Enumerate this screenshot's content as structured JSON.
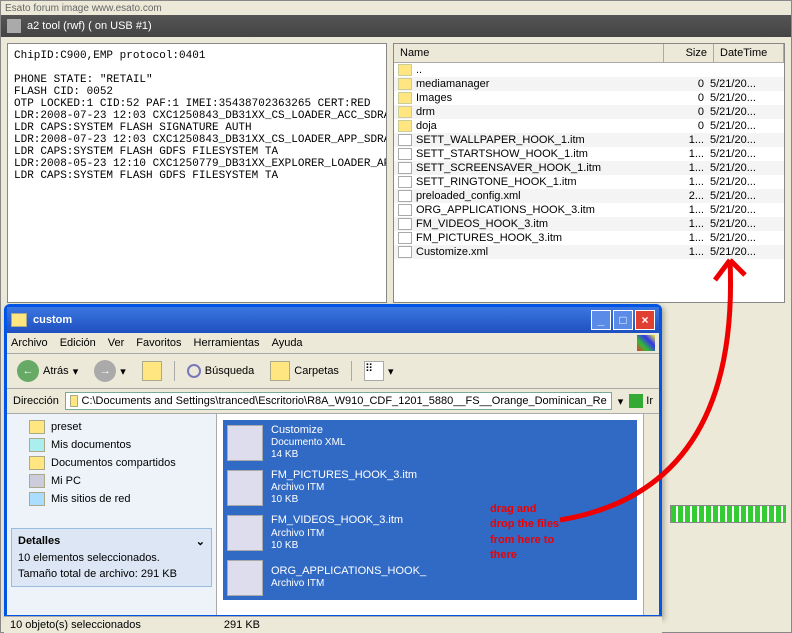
{
  "watermark": "Esato forum image www.esato.com",
  "main_title": "a2 tool (rwf) ( on USB #1)",
  "log_text": "ChipID:C900,EMP protocol:0401\n\nPHONE STATE: \"RETAIL\"\nFLASH CID: 0052\nOTP LOCKED:1 CID:52 PAF:1 IMEI:35438702363265 CERT:RED\nLDR:2008-07-23 12:03 CXC1250843_DB31XX_CS_LOADER_ACC_SDRAM_R\nLDR CAPS:SYSTEM FLASH SIGNATURE AUTH\nLDR:2008-07-23 12:03 CXC1250843_DB31XX_CS_LOADER_APP_SDRAM_R\nLDR CAPS:SYSTEM FLASH GDFS FILESYSTEM TA\nLDR:2008-05-23 12:10 CXC1250779_DB31XX_EXPLORER_LOADER_APP_S\nLDR CAPS:SYSTEM FLASH GDFS FILESYSTEM TA",
  "filelist": {
    "headers": {
      "name": "Name",
      "size": "Size",
      "date": "DateTime"
    },
    "rows": [
      {
        "icon": "up",
        "name": "..",
        "size": "",
        "date": ""
      },
      {
        "icon": "folder",
        "name": "mediamanager",
        "size": "0",
        "date": "5/21/20..."
      },
      {
        "icon": "folder",
        "name": "Images",
        "size": "0",
        "date": "5/21/20..."
      },
      {
        "icon": "folder",
        "name": "drm",
        "size": "0",
        "date": "5/21/20..."
      },
      {
        "icon": "folder",
        "name": "doja",
        "size": "0",
        "date": "5/21/20..."
      },
      {
        "icon": "file",
        "name": "SETT_WALLPAPER_HOOK_1.itm",
        "size": "1...",
        "date": "5/21/20..."
      },
      {
        "icon": "file",
        "name": "SETT_STARTSHOW_HOOK_1.itm",
        "size": "1...",
        "date": "5/21/20..."
      },
      {
        "icon": "file",
        "name": "SETT_SCREENSAVER_HOOK_1.itm",
        "size": "1...",
        "date": "5/21/20..."
      },
      {
        "icon": "file",
        "name": "SETT_RINGTONE_HOOK_1.itm",
        "size": "1...",
        "date": "5/21/20..."
      },
      {
        "icon": "file",
        "name": "preloaded_config.xml",
        "size": "2...",
        "date": "5/21/20..."
      },
      {
        "icon": "file",
        "name": "ORG_APPLICATIONS_HOOK_3.itm",
        "size": "1...",
        "date": "5/21/20..."
      },
      {
        "icon": "file",
        "name": "FM_VIDEOS_HOOK_3.itm",
        "size": "1...",
        "date": "5/21/20..."
      },
      {
        "icon": "file",
        "name": "FM_PICTURES_HOOK_3.itm",
        "size": "1...",
        "date": "5/21/20..."
      },
      {
        "icon": "file",
        "name": "Customize.xml",
        "size": "1...",
        "date": "5/21/20..."
      }
    ]
  },
  "explorer": {
    "title": "custom",
    "menu": [
      "Archivo",
      "Edición",
      "Ver",
      "Favoritos",
      "Herramientas",
      "Ayuda"
    ],
    "back": "Atrás",
    "search": "Búsqueda",
    "folders": "Carpetas",
    "addr_label": "Dirección",
    "addr_path": "C:\\Documents and Settings\\tranced\\Escritorio\\R8A_W910_CDF_1201_5880__FS__Orange_Dominican_Re",
    "go": "Ir",
    "side_items": [
      {
        "label": "preset",
        "icon": "folder"
      },
      {
        "label": "Mis documentos",
        "icon": "doc"
      },
      {
        "label": "Documentos compartidos",
        "icon": "folder"
      },
      {
        "label": "Mi PC",
        "icon": "pc"
      },
      {
        "label": "Mis sitios de red",
        "icon": "net"
      }
    ],
    "details": {
      "title": "Detalles",
      "line1": "10 elementos seleccionados.",
      "line2": "Tamaño total de archivo: 291 KB"
    },
    "files": [
      {
        "name": "Customize",
        "type": "Documento XML",
        "size": "14 KB"
      },
      {
        "name": "FM_PICTURES_HOOK_3.itm",
        "type": "Archivo ITM",
        "size": "10 KB"
      },
      {
        "name": "FM_VIDEOS_HOOK_3.itm",
        "type": "Archivo ITM",
        "size": "10 KB"
      },
      {
        "name": "ORG_APPLICATIONS_HOOK_",
        "type": "Archivo ITM",
        "size": ""
      }
    ],
    "status": "10 objeto(s) seleccionados",
    "status_right": "291 KB"
  },
  "annotation": {
    "l1": "drag and",
    "l2": "drop the files",
    "l3": "from here to",
    "l4": "there"
  }
}
